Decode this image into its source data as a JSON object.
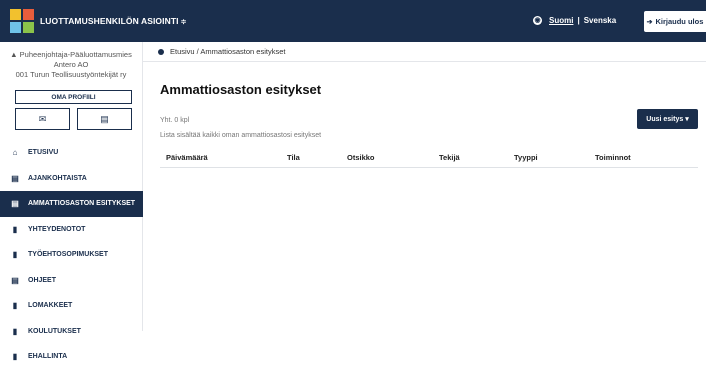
{
  "header": {
    "app_title": "LUOTTAMUSHENKILÖN ASIOINTI",
    "caret": "≑",
    "lang_active": "Suomi",
    "lang_sep": "|",
    "lang_other": "Svenska",
    "logout_label": "Kirjaudu ulos",
    "colors": {
      "header_bg": "#1a2e4c",
      "logo": [
        "#f2c12e",
        "#e85d3c",
        "#6fc3e8",
        "#8bc34a"
      ]
    }
  },
  "sidebar": {
    "user_role": "Puheenjohtaja-Pääluottamusmies",
    "user_name": "Antero AO",
    "user_org": "001 Turun Teollisuustyöntekijät ry",
    "profile_btn": "OMA PROFIILI",
    "items": [
      {
        "label": "ETUSIVU",
        "icon": "home-icon",
        "glyph": "⌂"
      },
      {
        "label": "AJANKOHTAISTA",
        "icon": "news-icon",
        "glyph": "▤"
      },
      {
        "label": "AMMATTIOSASTON ESITYKSET",
        "icon": "document-icon",
        "glyph": "▤"
      },
      {
        "label": "YHTEYDENOTOT",
        "icon": "file-icon",
        "glyph": "▮"
      },
      {
        "label": "TYÖEHTOSOPIMUKSET",
        "icon": "file-icon",
        "glyph": "▮"
      },
      {
        "label": "OHJEET",
        "icon": "news-icon",
        "glyph": "▤"
      },
      {
        "label": "LOMAKKEET",
        "icon": "file-icon",
        "glyph": "▮"
      },
      {
        "label": "KOULUTUKSET",
        "icon": "file-icon",
        "glyph": "▮"
      },
      {
        "label": "EHALLINTA",
        "icon": "file-icon",
        "glyph": "▮"
      }
    ]
  },
  "main": {
    "breadcrumb": "Etusivu / Ammattiosaston esitykset",
    "title": "Ammattiosaston esitykset",
    "count": "Yht. 0 kpl",
    "description": "Lista sisältää kaikki oman ammattiosastosi esitykset",
    "new_button": "Uusi esitys ▾",
    "columns": [
      "Päivämäärä",
      "Tila",
      "Otsikko",
      "Tekijä",
      "Tyyppi",
      "Toiminnot"
    ]
  }
}
